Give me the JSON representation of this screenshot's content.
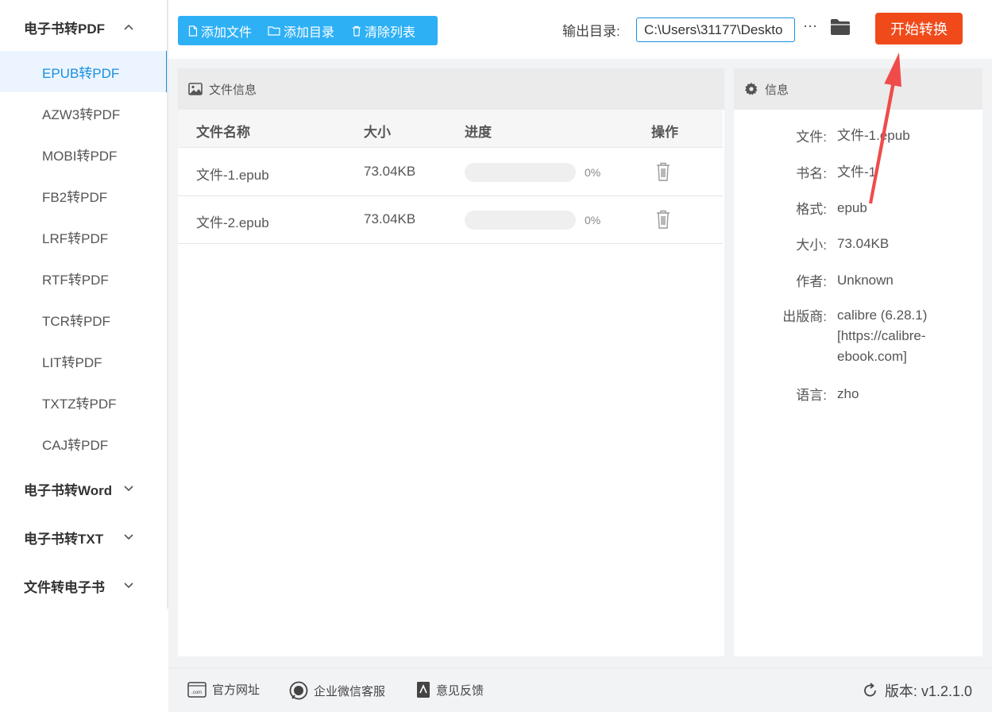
{
  "sidebar": {
    "groups": [
      {
        "label": "电子书转PDF",
        "expanded": true
      },
      {
        "label": "电子书转Word",
        "expanded": false
      },
      {
        "label": "电子书转TXT",
        "expanded": false
      },
      {
        "label": "文件转电子书",
        "expanded": false
      }
    ],
    "items": [
      "EPUB转PDF",
      "AZW3转PDF",
      "MOBI转PDF",
      "FB2转PDF",
      "LRF转PDF",
      "RTF转PDF",
      "TCR转PDF",
      "LIT转PDF",
      "TXTZ转PDF",
      "CAJ转PDF"
    ],
    "active_item": "EPUB转PDF"
  },
  "toolbar": {
    "add_file": "添加文件",
    "add_dir": "添加目录",
    "clear_list": "清除列表",
    "output_label": "输出目录:",
    "output_value": "C:\\Users\\31177\\Deskto",
    "more": "···",
    "start": "开始转换"
  },
  "file_panel": {
    "title": "文件信息",
    "columns": {
      "name": "文件名称",
      "size": "大小",
      "progress": "进度",
      "action": "操作"
    },
    "rows": [
      {
        "name": "文件-1.epub",
        "size": "73.04KB",
        "progress": 0,
        "progress_text": "0%"
      },
      {
        "name": "文件-2.epub",
        "size": "73.04KB",
        "progress": 0,
        "progress_text": "0%"
      }
    ]
  },
  "info_panel": {
    "title": "信息",
    "fields": [
      {
        "k": "文件:",
        "v": "文件-1.epub"
      },
      {
        "k": "书名:",
        "v": "文件-1"
      },
      {
        "k": "格式:",
        "v": "epub"
      },
      {
        "k": "大小:",
        "v": "73.04KB"
      },
      {
        "k": "作者:",
        "v": "Unknown"
      },
      {
        "k": "出版商:",
        "v": "calibre (6.28.1) [https://calibre-ebook.com]"
      },
      {
        "k": "语言:",
        "v": "zho"
      }
    ]
  },
  "footer": {
    "website": "官方网址",
    "wechat": "企业微信客服",
    "feedback": "意见反馈",
    "version": "版本: v1.2.1.0"
  },
  "colors": {
    "accent": "#1a8fe0",
    "toolbar_blue": "#2eb0f5",
    "start_red": "#f04a1a",
    "annotation": "#f04b4b"
  }
}
